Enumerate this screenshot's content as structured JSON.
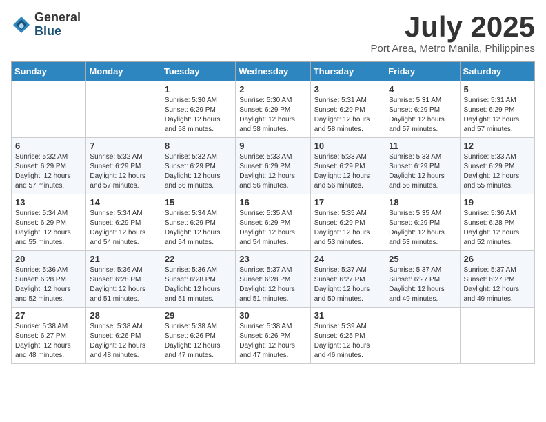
{
  "logo": {
    "general": "General",
    "blue": "Blue"
  },
  "header": {
    "month": "July 2025",
    "location": "Port Area, Metro Manila, Philippines"
  },
  "days_of_week": [
    "Sunday",
    "Monday",
    "Tuesday",
    "Wednesday",
    "Thursday",
    "Friday",
    "Saturday"
  ],
  "weeks": [
    [
      {
        "day": "",
        "info": ""
      },
      {
        "day": "",
        "info": ""
      },
      {
        "day": "1",
        "info": "Sunrise: 5:30 AM\nSunset: 6:29 PM\nDaylight: 12 hours and 58 minutes."
      },
      {
        "day": "2",
        "info": "Sunrise: 5:30 AM\nSunset: 6:29 PM\nDaylight: 12 hours and 58 minutes."
      },
      {
        "day": "3",
        "info": "Sunrise: 5:31 AM\nSunset: 6:29 PM\nDaylight: 12 hours and 58 minutes."
      },
      {
        "day": "4",
        "info": "Sunrise: 5:31 AM\nSunset: 6:29 PM\nDaylight: 12 hours and 57 minutes."
      },
      {
        "day": "5",
        "info": "Sunrise: 5:31 AM\nSunset: 6:29 PM\nDaylight: 12 hours and 57 minutes."
      }
    ],
    [
      {
        "day": "6",
        "info": "Sunrise: 5:32 AM\nSunset: 6:29 PM\nDaylight: 12 hours and 57 minutes."
      },
      {
        "day": "7",
        "info": "Sunrise: 5:32 AM\nSunset: 6:29 PM\nDaylight: 12 hours and 57 minutes."
      },
      {
        "day": "8",
        "info": "Sunrise: 5:32 AM\nSunset: 6:29 PM\nDaylight: 12 hours and 56 minutes."
      },
      {
        "day": "9",
        "info": "Sunrise: 5:33 AM\nSunset: 6:29 PM\nDaylight: 12 hours and 56 minutes."
      },
      {
        "day": "10",
        "info": "Sunrise: 5:33 AM\nSunset: 6:29 PM\nDaylight: 12 hours and 56 minutes."
      },
      {
        "day": "11",
        "info": "Sunrise: 5:33 AM\nSunset: 6:29 PM\nDaylight: 12 hours and 56 minutes."
      },
      {
        "day": "12",
        "info": "Sunrise: 5:33 AM\nSunset: 6:29 PM\nDaylight: 12 hours and 55 minutes."
      }
    ],
    [
      {
        "day": "13",
        "info": "Sunrise: 5:34 AM\nSunset: 6:29 PM\nDaylight: 12 hours and 55 minutes."
      },
      {
        "day": "14",
        "info": "Sunrise: 5:34 AM\nSunset: 6:29 PM\nDaylight: 12 hours and 54 minutes."
      },
      {
        "day": "15",
        "info": "Sunrise: 5:34 AM\nSunset: 6:29 PM\nDaylight: 12 hours and 54 minutes."
      },
      {
        "day": "16",
        "info": "Sunrise: 5:35 AM\nSunset: 6:29 PM\nDaylight: 12 hours and 54 minutes."
      },
      {
        "day": "17",
        "info": "Sunrise: 5:35 AM\nSunset: 6:29 PM\nDaylight: 12 hours and 53 minutes."
      },
      {
        "day": "18",
        "info": "Sunrise: 5:35 AM\nSunset: 6:29 PM\nDaylight: 12 hours and 53 minutes."
      },
      {
        "day": "19",
        "info": "Sunrise: 5:36 AM\nSunset: 6:28 PM\nDaylight: 12 hours and 52 minutes."
      }
    ],
    [
      {
        "day": "20",
        "info": "Sunrise: 5:36 AM\nSunset: 6:28 PM\nDaylight: 12 hours and 52 minutes."
      },
      {
        "day": "21",
        "info": "Sunrise: 5:36 AM\nSunset: 6:28 PM\nDaylight: 12 hours and 51 minutes."
      },
      {
        "day": "22",
        "info": "Sunrise: 5:36 AM\nSunset: 6:28 PM\nDaylight: 12 hours and 51 minutes."
      },
      {
        "day": "23",
        "info": "Sunrise: 5:37 AM\nSunset: 6:28 PM\nDaylight: 12 hours and 51 minutes."
      },
      {
        "day": "24",
        "info": "Sunrise: 5:37 AM\nSunset: 6:27 PM\nDaylight: 12 hours and 50 minutes."
      },
      {
        "day": "25",
        "info": "Sunrise: 5:37 AM\nSunset: 6:27 PM\nDaylight: 12 hours and 49 minutes."
      },
      {
        "day": "26",
        "info": "Sunrise: 5:37 AM\nSunset: 6:27 PM\nDaylight: 12 hours and 49 minutes."
      }
    ],
    [
      {
        "day": "27",
        "info": "Sunrise: 5:38 AM\nSunset: 6:27 PM\nDaylight: 12 hours and 48 minutes."
      },
      {
        "day": "28",
        "info": "Sunrise: 5:38 AM\nSunset: 6:26 PM\nDaylight: 12 hours and 48 minutes."
      },
      {
        "day": "29",
        "info": "Sunrise: 5:38 AM\nSunset: 6:26 PM\nDaylight: 12 hours and 47 minutes."
      },
      {
        "day": "30",
        "info": "Sunrise: 5:38 AM\nSunset: 6:26 PM\nDaylight: 12 hours and 47 minutes."
      },
      {
        "day": "31",
        "info": "Sunrise: 5:39 AM\nSunset: 6:25 PM\nDaylight: 12 hours and 46 minutes."
      },
      {
        "day": "",
        "info": ""
      },
      {
        "day": "",
        "info": ""
      }
    ]
  ]
}
